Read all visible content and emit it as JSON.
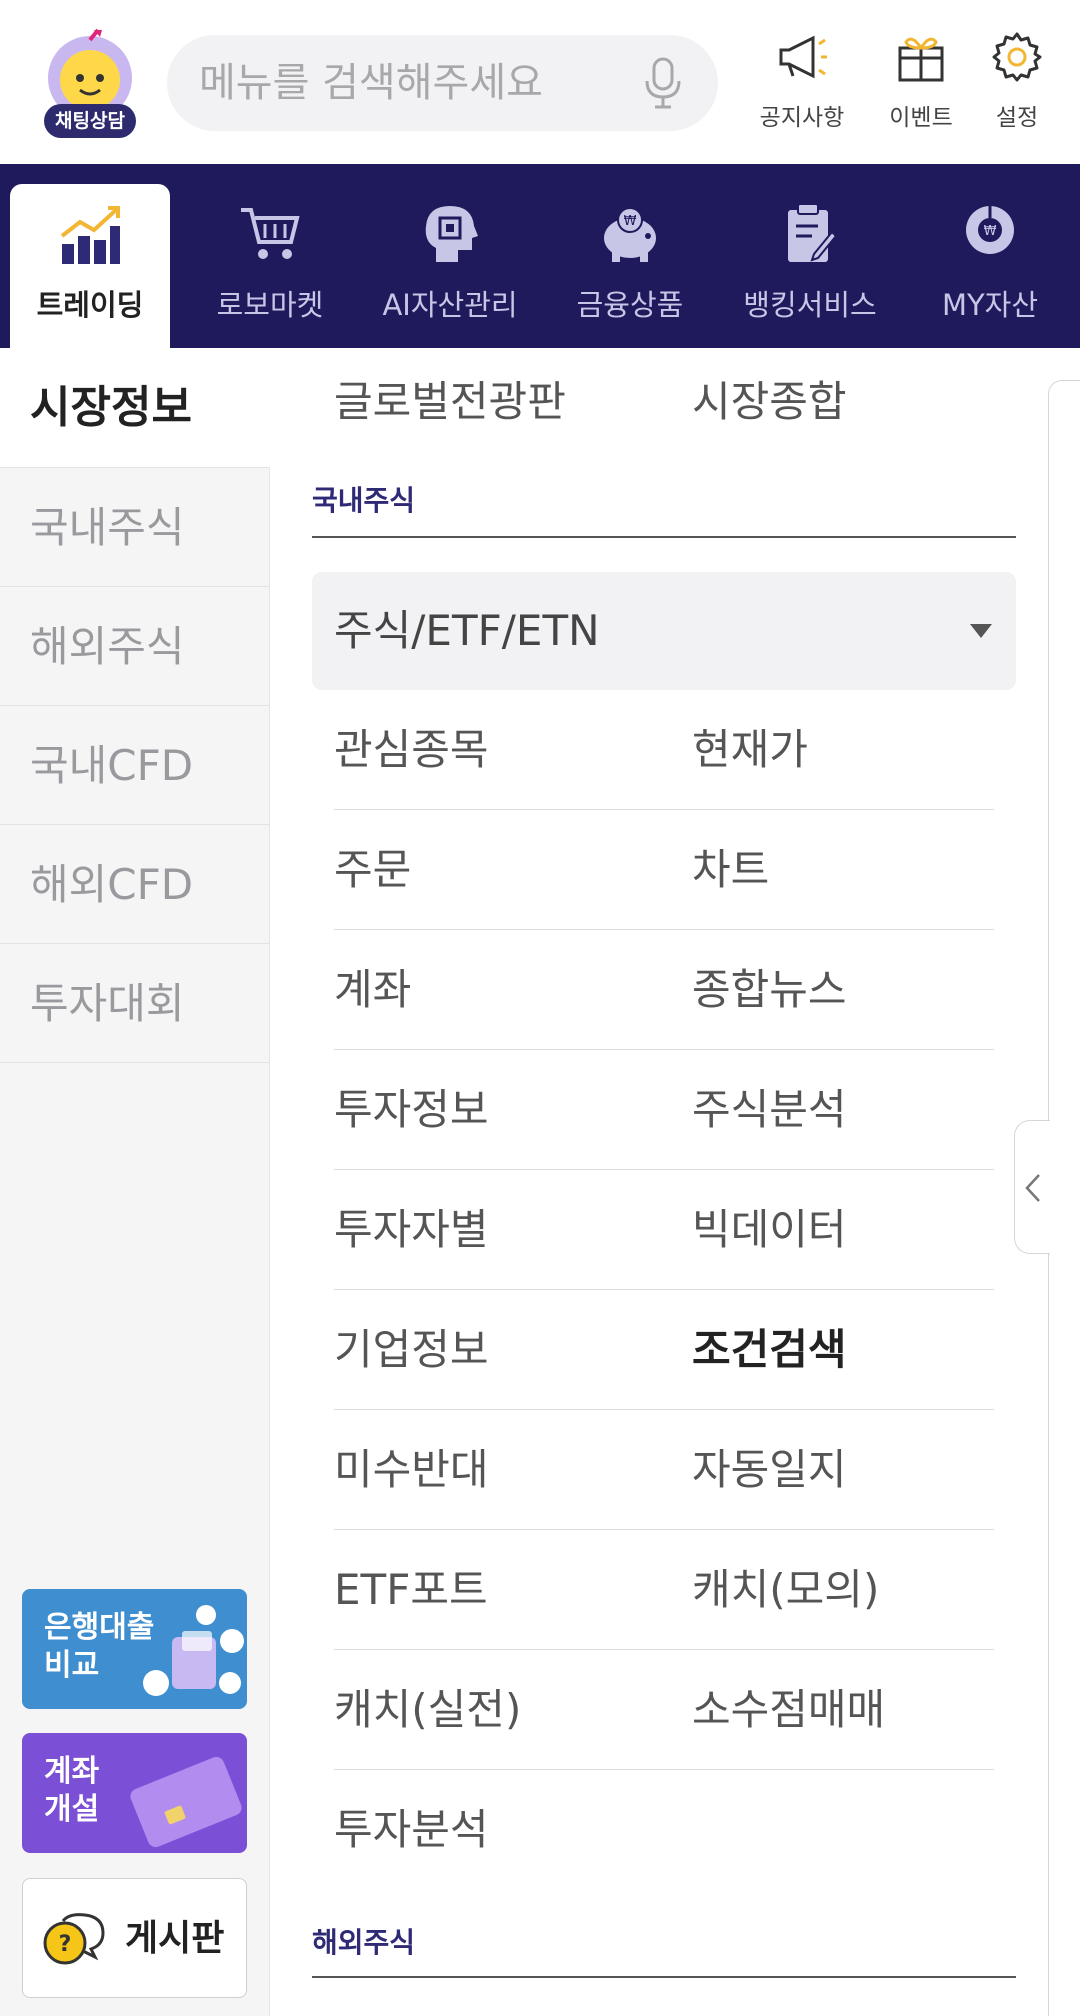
{
  "header": {
    "chat_label": "채팅상담",
    "search_placeholder": "메뉴를 검색해주세요",
    "buttons": [
      {
        "label": "공지사항",
        "icon": "megaphone-icon"
      },
      {
        "label": "이벤트",
        "icon": "gift-icon"
      },
      {
        "label": "설정",
        "icon": "gear-icon"
      }
    ]
  },
  "categories": [
    {
      "label": "트레이딩",
      "icon": "trading-chart-icon",
      "active": true
    },
    {
      "label": "로보마켓",
      "icon": "cart-icon"
    },
    {
      "label": "AI자산관리",
      "icon": "ai-head-icon"
    },
    {
      "label": "금융상품",
      "icon": "piggy-bank-icon"
    },
    {
      "label": "뱅킹서비스",
      "icon": "clipboard-icon"
    },
    {
      "label": "MY자산",
      "icon": "donut-chart-icon"
    }
  ],
  "sidebar": {
    "title": "시장정보",
    "items": [
      "국내주식",
      "해외주식",
      "국내CFD",
      "해외CFD",
      "투자대회"
    ],
    "banners": {
      "loan": "은행대출\n비교",
      "account": "계좌\n개설",
      "board": "게시판"
    }
  },
  "content": {
    "top_links": [
      "글로벌전광판",
      "시장종합"
    ],
    "section1": "국내주식",
    "dropdown_value": "주식/ETF/ETN",
    "menu": [
      [
        "관심종목",
        "현재가"
      ],
      [
        "주문",
        "차트"
      ],
      [
        "계좌",
        "종합뉴스"
      ],
      [
        "투자정보",
        "주식분석"
      ],
      [
        "투자자별",
        "빅데이터"
      ],
      [
        "기업정보",
        "조건검색"
      ],
      [
        "미수반대",
        "자동일지"
      ],
      [
        "ETF포트",
        "캐치(모의)"
      ],
      [
        "캐치(실전)",
        "소수점매매"
      ],
      [
        "투자분석",
        ""
      ]
    ],
    "section2": "해외주식"
  },
  "colors": {
    "nav_bg": "#1e1a5c",
    "section_heading": "#2e2a75",
    "loan_banner": "#3f8ed0",
    "account_banner": "#7b4fd6"
  }
}
